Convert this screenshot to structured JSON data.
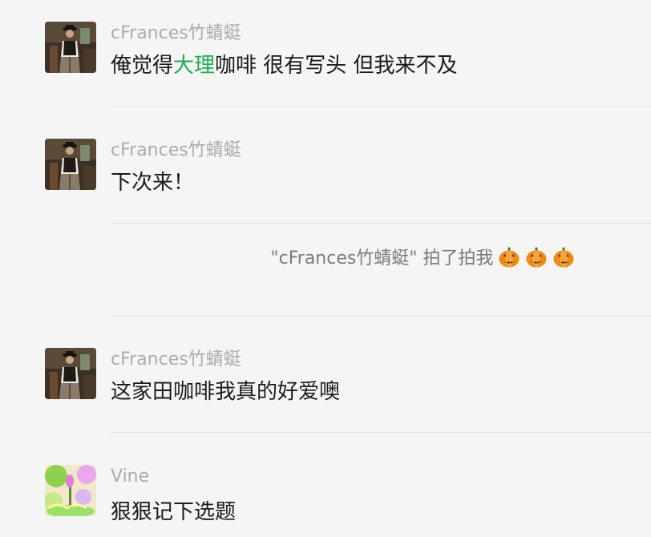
{
  "messages": [
    {
      "sender": "cFrances竹蜻蜓",
      "text_before": "俺觉得",
      "text_highlight": "大理",
      "text_after": "咖啡 很有写头 但我来不及"
    },
    {
      "sender": "cFrances竹蜻蜓",
      "text": "下次来！"
    },
    {
      "sender": "cFrances竹蜻蜓",
      "text": "这家田咖啡我真的好爱噢"
    },
    {
      "sender": "Vine",
      "text": "狠狠记下选题"
    }
  ],
  "system_notice": {
    "text": "\"cFrances竹蜻蜓\" 拍了拍我",
    "emoji_icons": [
      "pumpkin-icon",
      "pumpkin-icon",
      "pumpkin-icon"
    ]
  },
  "colors": {
    "highlight": "#1aad52",
    "sender": "#ababab",
    "background": "#f5f5f5"
  }
}
